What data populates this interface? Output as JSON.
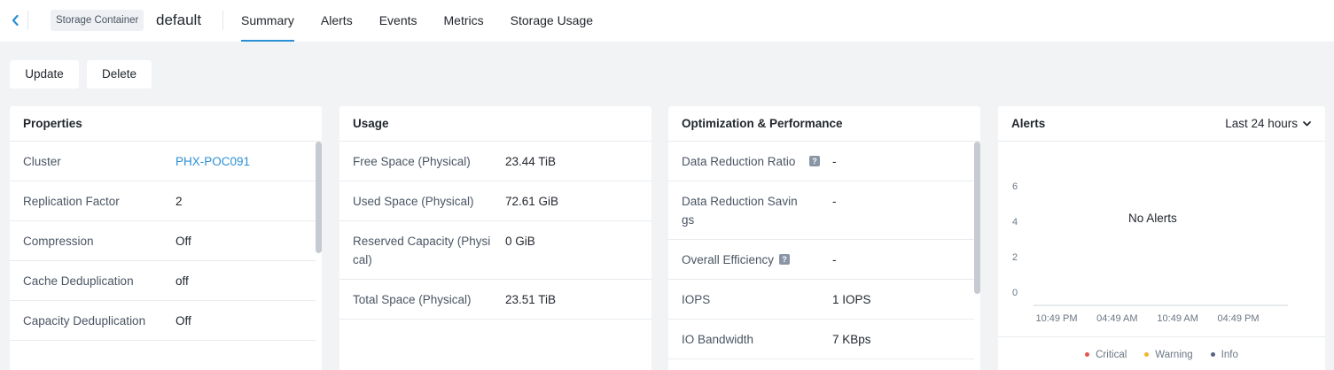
{
  "header": {
    "entity_type": "Storage Container",
    "entity_name": "default",
    "tabs": [
      {
        "label": "Summary",
        "active": true
      },
      {
        "label": "Alerts",
        "active": false
      },
      {
        "label": "Events",
        "active": false
      },
      {
        "label": "Metrics",
        "active": false
      },
      {
        "label": "Storage Usage",
        "active": false
      }
    ]
  },
  "actions": {
    "update_label": "Update",
    "delete_label": "Delete"
  },
  "properties": {
    "title": "Properties",
    "rows": [
      {
        "label": "Cluster",
        "value": "PHX-POC091"
      },
      {
        "label": "Replication Factor",
        "value": "2"
      },
      {
        "label": "Compression",
        "value": "Off"
      },
      {
        "label": "Cache Deduplication",
        "value": "off"
      },
      {
        "label": "Capacity Deduplication",
        "value": "Off"
      }
    ]
  },
  "usage": {
    "title": "Usage",
    "rows": [
      {
        "label": "Free Space (Physical)",
        "value": "23.44 TiB"
      },
      {
        "label": "Used Space (Physical)",
        "value": "72.61 GiB"
      },
      {
        "label": "Reserved Capacity (Physical)",
        "value": "0 GiB"
      },
      {
        "label": "Total Space (Physical)",
        "value": "23.51 TiB"
      }
    ]
  },
  "optimization": {
    "title": "Optimization & Performance",
    "rows": [
      {
        "label": "Data Reduction Ratio",
        "value": "-"
      },
      {
        "label": "Data Reduction Savings",
        "value": "-"
      },
      {
        "label": "Overall Efficiency",
        "value": "-"
      },
      {
        "label": "IOPS",
        "value": "1 IOPS"
      },
      {
        "label": "IO Bandwidth",
        "value": "7 KBps"
      }
    ]
  },
  "alerts": {
    "title": "Alerts",
    "range_label": "Last 24 hours",
    "empty_text": "No Alerts",
    "legend": [
      {
        "label": "Critical",
        "color": "#e8534a"
      },
      {
        "label": "Warning",
        "color": "#f5b52a"
      },
      {
        "label": "Info",
        "color": "#5a6380"
      }
    ]
  },
  "chart_data": {
    "type": "bar",
    "categories": [
      "10:49 PM",
      "04:49 AM",
      "10:49 AM",
      "04:49 PM"
    ],
    "series": [],
    "y_ticks": [
      0,
      2,
      4,
      6
    ],
    "ylim": [
      0,
      6
    ],
    "grid": false,
    "legend_placement": "bottom"
  },
  "colors": {
    "accent": "#2b8fd6",
    "scrollbar": "#c6cbd1"
  }
}
